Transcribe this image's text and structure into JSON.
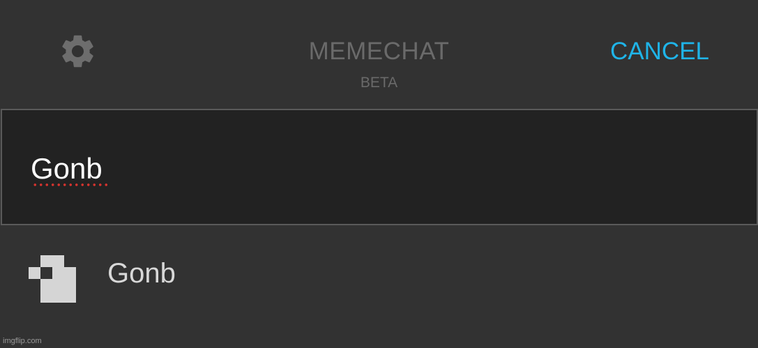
{
  "header": {
    "settings_icon": "gear-icon",
    "title": "MEMECHAT",
    "subtitle": "BETA",
    "cancel_label": "CANCEL"
  },
  "search": {
    "value": "Gonb",
    "spellcheck_underline": true
  },
  "results": [
    {
      "avatar_icon": "pixel-avatar-icon",
      "name": "Gonb"
    }
  ],
  "watermark": "imgflip.com",
  "colors": {
    "background": "#323232",
    "search_background": "#222222",
    "accent": "#1fb4e8",
    "muted_text": "#6a6a6a",
    "spellcheck": "#d8332e"
  }
}
